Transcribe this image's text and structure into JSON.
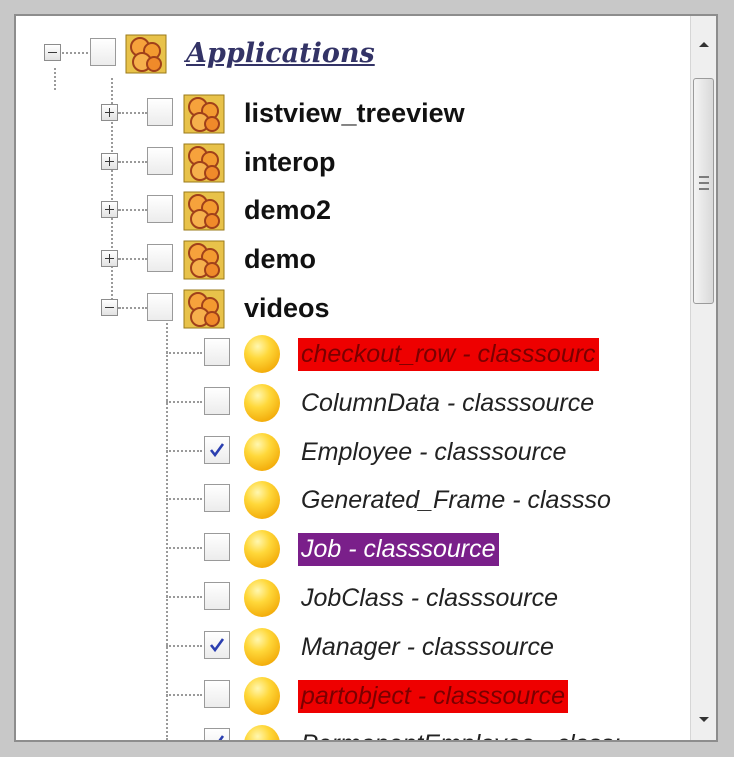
{
  "tree": {
    "root": {
      "label": "Applications",
      "expanded": true,
      "checked": false
    },
    "packages": [
      {
        "label": "listview_treeview",
        "expanded": false,
        "checked": false
      },
      {
        "label": "interop",
        "expanded": false,
        "checked": false
      },
      {
        "label": "demo2",
        "expanded": false,
        "checked": false
      },
      {
        "label": "demo",
        "expanded": false,
        "checked": false
      },
      {
        "label": "videos",
        "expanded": true,
        "checked": false
      }
    ],
    "classes": [
      {
        "label": "checkout_row - classsourc",
        "checked": false,
        "highlight": "red"
      },
      {
        "label": "ColumnData - classsource",
        "checked": false,
        "highlight": "none"
      },
      {
        "label": "Employee - classsource",
        "checked": true,
        "highlight": "none"
      },
      {
        "label": "Generated_Frame - classso",
        "checked": false,
        "highlight": "none"
      },
      {
        "label": "Job - classsource",
        "checked": false,
        "highlight": "purple"
      },
      {
        "label": "JobClass - classsource",
        "checked": false,
        "highlight": "none"
      },
      {
        "label": "Manager - classsource",
        "checked": true,
        "highlight": "none"
      },
      {
        "label": "partobject - classsource",
        "checked": false,
        "highlight": "red"
      },
      {
        "label": "PermanentEmployee - class:",
        "checked": true,
        "highlight": "none"
      }
    ]
  },
  "icons": {
    "package": "package-icon",
    "class": "class-icon",
    "scroll_up": "scroll-up-arrow-icon",
    "scroll_down": "scroll-down-arrow-icon"
  },
  "colors": {
    "highlight_red": "#ee0000",
    "highlight_purple": "#7a1f8a",
    "root_label": "#333366"
  }
}
